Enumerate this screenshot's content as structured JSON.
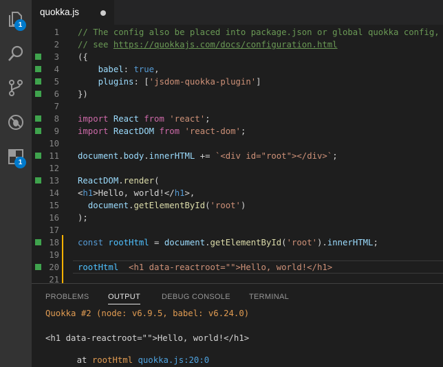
{
  "activity_bar": {
    "explorer_badge": "1",
    "extensions_badge": "1"
  },
  "tab": {
    "title": "quokka.js"
  },
  "editor": {
    "lines": [
      {
        "num": "1",
        "mark": false,
        "tokens": [
          {
            "t": "// The config also be placed into package.json or global quokka config,",
            "c": "comment"
          }
        ]
      },
      {
        "num": "2",
        "mark": false,
        "tokens": [
          {
            "t": "// see ",
            "c": "comment"
          },
          {
            "t": "https://quokkajs.com/docs/configuration.html",
            "c": "link"
          }
        ]
      },
      {
        "num": "3",
        "mark": true,
        "tokens": [
          {
            "t": "({",
            "c": "def"
          }
        ]
      },
      {
        "num": "4",
        "mark": true,
        "tokens": [
          {
            "t": "    ",
            "c": "def"
          },
          {
            "t": "babel",
            "c": "prop"
          },
          {
            "t": ": ",
            "c": "def"
          },
          {
            "t": "true",
            "c": "bool"
          },
          {
            "t": ",",
            "c": "def"
          }
        ]
      },
      {
        "num": "5",
        "mark": true,
        "tokens": [
          {
            "t": "    ",
            "c": "def"
          },
          {
            "t": "plugins",
            "c": "prop"
          },
          {
            "t": ": [",
            "c": "def"
          },
          {
            "t": "'jsdom-quokka-plugin'",
            "c": "str"
          },
          {
            "t": "]",
            "c": "def"
          }
        ]
      },
      {
        "num": "6",
        "mark": true,
        "tokens": [
          {
            "t": "})",
            "c": "def"
          }
        ]
      },
      {
        "num": "7",
        "mark": false,
        "tokens": []
      },
      {
        "num": "8",
        "mark": true,
        "tokens": [
          {
            "t": "import ",
            "c": "kw"
          },
          {
            "t": "React ",
            "c": "prop"
          },
          {
            "t": "from ",
            "c": "kw"
          },
          {
            "t": "'react'",
            "c": "str"
          },
          {
            "t": ";",
            "c": "def"
          }
        ]
      },
      {
        "num": "9",
        "mark": true,
        "tokens": [
          {
            "t": "import ",
            "c": "kw"
          },
          {
            "t": "ReactDOM ",
            "c": "prop"
          },
          {
            "t": "from ",
            "c": "kw"
          },
          {
            "t": "'react-dom'",
            "c": "str"
          },
          {
            "t": ";",
            "c": "def"
          }
        ]
      },
      {
        "num": "10",
        "mark": false,
        "tokens": []
      },
      {
        "num": "11",
        "mark": true,
        "tokens": [
          {
            "t": "document",
            "c": "prop"
          },
          {
            "t": ".",
            "c": "def"
          },
          {
            "t": "body",
            "c": "prop"
          },
          {
            "t": ".",
            "c": "def"
          },
          {
            "t": "innerHTML",
            "c": "prop"
          },
          {
            "t": " += ",
            "c": "def"
          },
          {
            "t": "`<div id=\"root\"></div>`",
            "c": "str"
          },
          {
            "t": ";",
            "c": "def"
          }
        ]
      },
      {
        "num": "12",
        "mark": false,
        "tokens": []
      },
      {
        "num": "13",
        "mark": true,
        "tokens": [
          {
            "t": "ReactDOM",
            "c": "prop"
          },
          {
            "t": ".",
            "c": "def"
          },
          {
            "t": "render",
            "c": "fn"
          },
          {
            "t": "(",
            "c": "def"
          }
        ]
      },
      {
        "num": "14",
        "mark": false,
        "tokens": [
          {
            "t": "<",
            "c": "def"
          },
          {
            "t": "h1",
            "c": "tag"
          },
          {
            "t": ">Hello, world!</",
            "c": "def"
          },
          {
            "t": "h1",
            "c": "tag"
          },
          {
            "t": ">,",
            "c": "def"
          }
        ]
      },
      {
        "num": "15",
        "mark": false,
        "tokens": [
          {
            "t": "  ",
            "c": "def"
          },
          {
            "t": "document",
            "c": "prop"
          },
          {
            "t": ".",
            "c": "def"
          },
          {
            "t": "getElementById",
            "c": "fn"
          },
          {
            "t": "(",
            "c": "def"
          },
          {
            "t": "'root'",
            "c": "str"
          },
          {
            "t": ")",
            "c": "def"
          }
        ]
      },
      {
        "num": "16",
        "mark": false,
        "tokens": [
          {
            "t": ");",
            "c": "def"
          }
        ]
      },
      {
        "num": "17",
        "mark": false,
        "tokens": []
      },
      {
        "num": "18",
        "mark": true,
        "tokens": [
          {
            "t": "const ",
            "c": "const"
          },
          {
            "t": "rootHtml",
            "c": "var"
          },
          {
            "t": " = ",
            "c": "def"
          },
          {
            "t": "document",
            "c": "prop"
          },
          {
            "t": ".",
            "c": "def"
          },
          {
            "t": "getElementById",
            "c": "fn"
          },
          {
            "t": "(",
            "c": "def"
          },
          {
            "t": "'root'",
            "c": "str"
          },
          {
            "t": ").",
            "c": "def"
          },
          {
            "t": "innerHTML",
            "c": "prop"
          },
          {
            "t": ";",
            "c": "def"
          }
        ]
      },
      {
        "num": "19",
        "mark": false,
        "tokens": []
      },
      {
        "num": "20",
        "mark": true,
        "tokens": [
          {
            "t": "rootHtml",
            "c": "var"
          },
          {
            "t": "  <h1 data-reactroot=\"\">Hello, world!</h1>",
            "c": "inline"
          }
        ]
      },
      {
        "num": "21",
        "mark": false,
        "tokens": []
      }
    ]
  },
  "panel": {
    "tabs": [
      "PROBLEMS",
      "OUTPUT",
      "DEBUG CONSOLE",
      "TERMINAL"
    ],
    "active_tab": "OUTPUT",
    "output": {
      "header": "Quokka #2 (node: v6.9.5, babel: v6.24.0)",
      "result": "<h1 data-reactroot=\"\">Hello, world!</h1>",
      "at_prefix": "at ",
      "at_name": "rootHtml",
      "at_location": "quokka.js:20:0"
    }
  },
  "colors": {
    "activity_bar": "#333333",
    "editor_bg": "#1e1e1e",
    "badge": "#007acc",
    "gutter_mark": "#3fa34d",
    "current_line_border": "#ffb300"
  }
}
